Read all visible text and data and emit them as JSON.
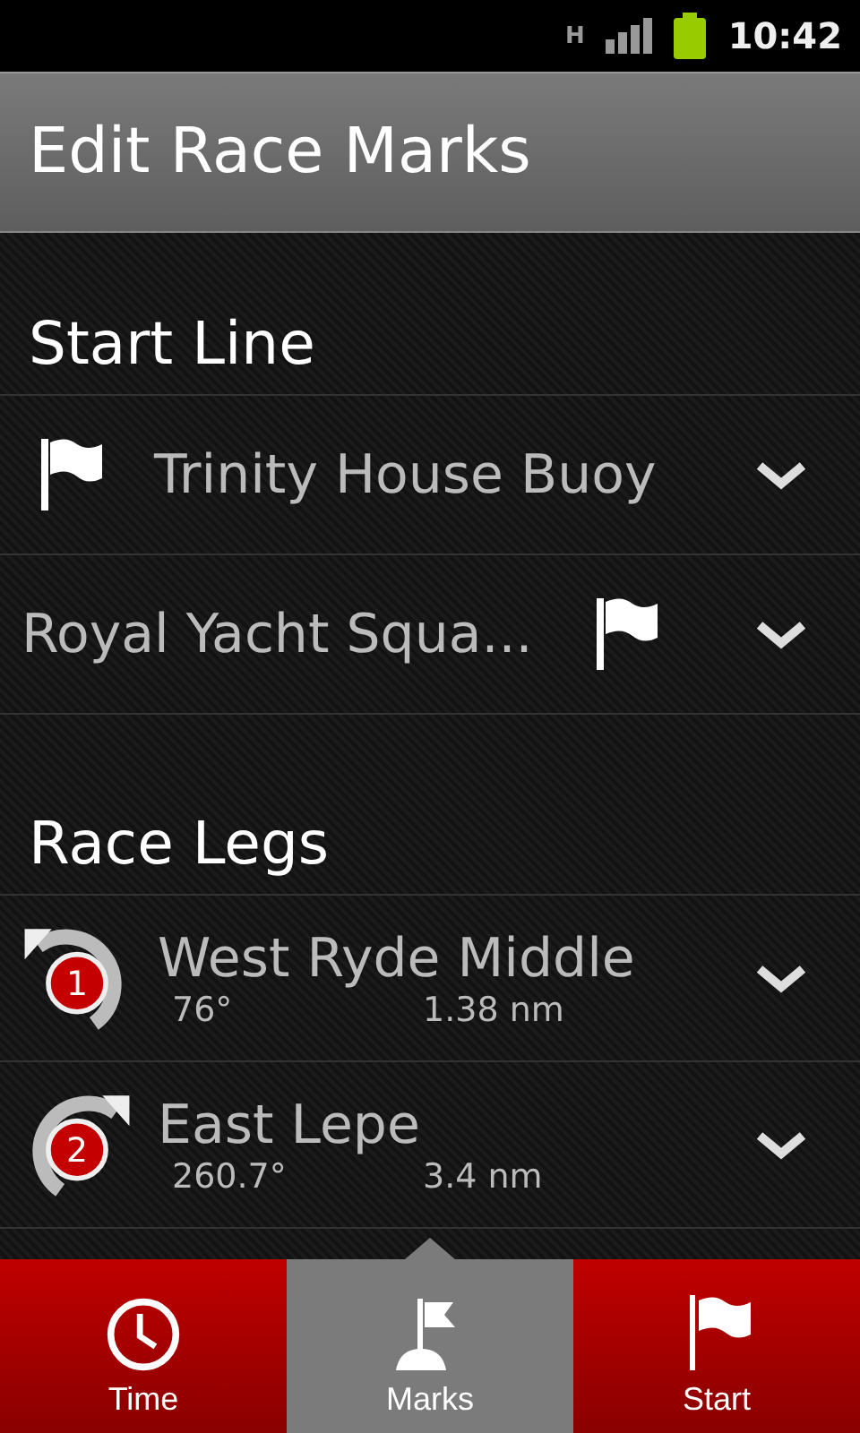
{
  "status_bar": {
    "network": "H",
    "time": "10:42"
  },
  "title": "Edit Race Marks",
  "sections": [
    {
      "title": "Start Line",
      "kind": "start",
      "rows": [
        {
          "name": "Trinity House Buoy",
          "kind": "flag_left"
        },
        {
          "name": "Royal Yacht Squa...",
          "kind": "flag_right"
        }
      ]
    },
    {
      "title": "Race Legs",
      "kind": "legs",
      "rows": [
        {
          "number": "1",
          "kind": "counterclockwise",
          "name": "West Ryde Middle",
          "bearing": "76°",
          "distance": "1.38 nm"
        },
        {
          "number": "2",
          "kind": "clockwise",
          "name": "East Lepe",
          "bearing": "260.7°",
          "distance": "3.4 nm"
        }
      ]
    }
  ],
  "tabs": [
    {
      "label": "Time",
      "selected": false
    },
    {
      "label": "Marks",
      "selected": true
    },
    {
      "label": "Start",
      "selected": false
    }
  ]
}
